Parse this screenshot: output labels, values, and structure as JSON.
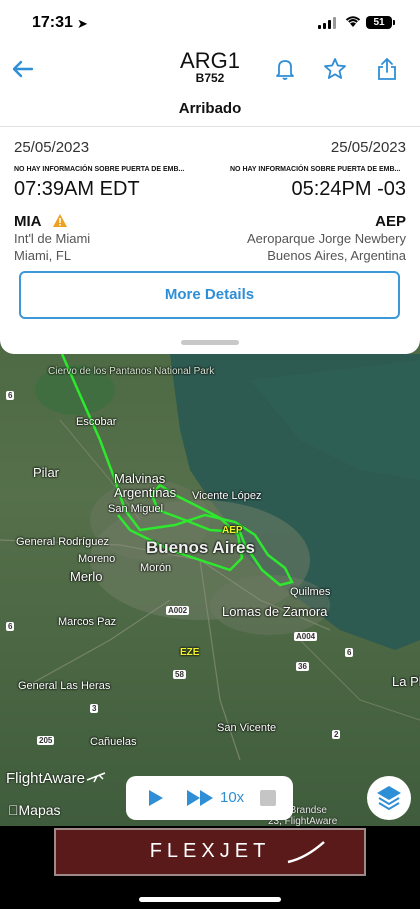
{
  "status_bar": {
    "time": "17:31",
    "battery": "51"
  },
  "header": {
    "flight_id": "ARG1",
    "aircraft_type": "B752",
    "status": "Arribado",
    "icons": [
      "back-arrow-icon",
      "bell-icon",
      "star-icon",
      "share-icon"
    ]
  },
  "departure": {
    "date": "25/05/2023",
    "gate_info": "NO HAY INFORMACIÓN SOBRE PUERTA DE EMB...",
    "time": "07:39AM EDT",
    "code": "MIA",
    "airport": "Int'l de Miami",
    "city": "Miami, FL",
    "warning_icon": "warning-icon"
  },
  "arrival": {
    "date": "25/05/2023",
    "gate_info": "NO HAY INFORMACIÓN SOBRE PUERTA DE EMB...",
    "time": "05:24PM -03",
    "code": "AEP",
    "airport": "Aeroparque Jorge Newbery",
    "city": "Buenos Aires, Argentina"
  },
  "more_details": "More Details",
  "map": {
    "labels": {
      "escobar": "Escobar",
      "pilar": "Pilar",
      "malvinas": "Malvinas",
      "argentinas": "Argentinas",
      "san_miguel": "San Miguel",
      "vicente_lopez": "Vicente López",
      "general_rodriguez": "General Rodríguez",
      "moreno": "Moreno",
      "merlo": "Merlo",
      "moron": "Morón",
      "buenos_aires": "Buenos Aires",
      "quilmes": "Quilmes",
      "lomas": "Lomas de Zamora",
      "marcos_paz": "Marcos Paz",
      "general_las_heras": "General Las Heras",
      "canuelas": "Cañuelas",
      "san_vicente": "San Vicente",
      "la_plata": "La Pl",
      "aep": "AEP",
      "eze": "EZE",
      "park": "Ciervo de los Pantanos National Park"
    },
    "shields": [
      "6",
      "6",
      "A002",
      "A004",
      "36",
      "58",
      "3",
      "205",
      "6",
      "2"
    ]
  },
  "brand": "FlightAware",
  "maps_credit": "Mapas",
  "copyright": "onel Brandse\n23, FlightAware",
  "playback": {
    "speed": "10x"
  },
  "ad": {
    "text": "FLEXJET"
  },
  "colors": {
    "accent": "#2f8fd6",
    "track": "#2ee82e",
    "water": "#2b5a52"
  }
}
